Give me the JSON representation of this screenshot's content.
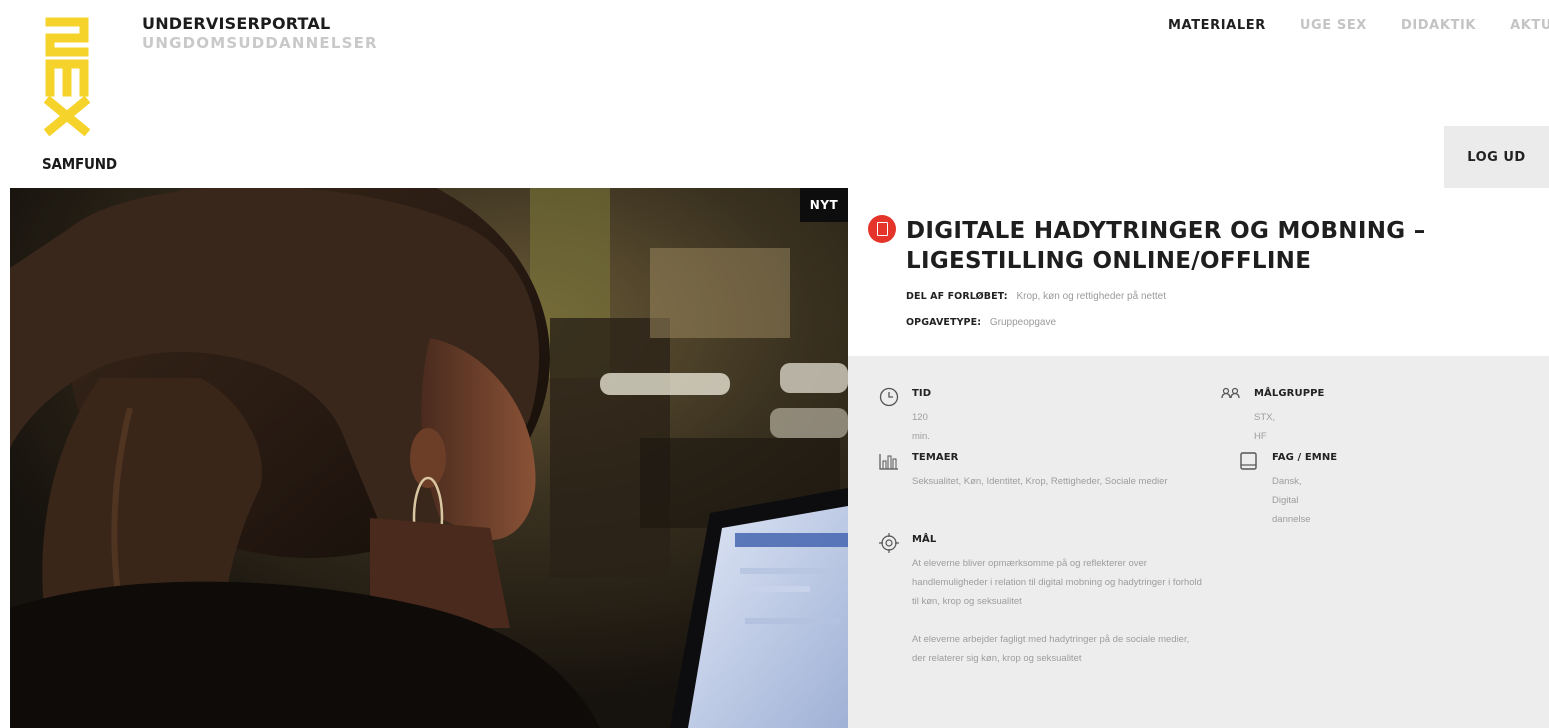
{
  "brand": {
    "logo_word": "SEX",
    "logo_sub": "SAMFUND",
    "portal_title": "UNDERVISERPORTAL",
    "portal_subtitle": "UNGDOMSUDDANNELSER",
    "accent_color": "#f6d32b"
  },
  "nav": {
    "items": [
      {
        "label": "MATERIALER",
        "active": true
      },
      {
        "label": "UGE SEX",
        "active": false
      },
      {
        "label": "DIDAKTIK",
        "active": false
      },
      {
        "label": "AKTUELT",
        "active": false
      }
    ],
    "logout_label": "LOG UD"
  },
  "hero": {
    "badge": "NYT"
  },
  "material": {
    "icon": "document-icon",
    "icon_color": "#e5342a",
    "title": "DIGITALE HADYTRINGER OG MOBNING – LIGESTILLING ONLINE/OFFLINE",
    "course_label": "DEL AF FORLØBET:",
    "course_value": "Krop, køn og rettigheder på nettet",
    "tasktype_label": "OPGAVETYPE:",
    "tasktype_value": "Gruppeopgave"
  },
  "details": {
    "tid": {
      "label": "TID",
      "value": "120 min."
    },
    "malgruppe": {
      "label": "MÅLGRUPPE",
      "value": "STX, HF"
    },
    "temaer": {
      "label": "TEMAER",
      "value": "Seksualitet, Køn, Identitet, Krop, Rettigheder, Sociale medier"
    },
    "fag": {
      "label": "FAG / EMNE",
      "value": "Dansk, Digital dannelse"
    },
    "mal": {
      "label": "MÅL",
      "paragraphs": [
        "At eleverne bliver opmærksomme på og reflekterer over handlemuligheder i relation til digital mobning og hadytringer i forhold til køn, krop og seksualitet",
        "At eleverne arbejder fagligt med hadytringer på de sociale medier, der relaterer sig køn, krop og seksualitet"
      ]
    }
  }
}
